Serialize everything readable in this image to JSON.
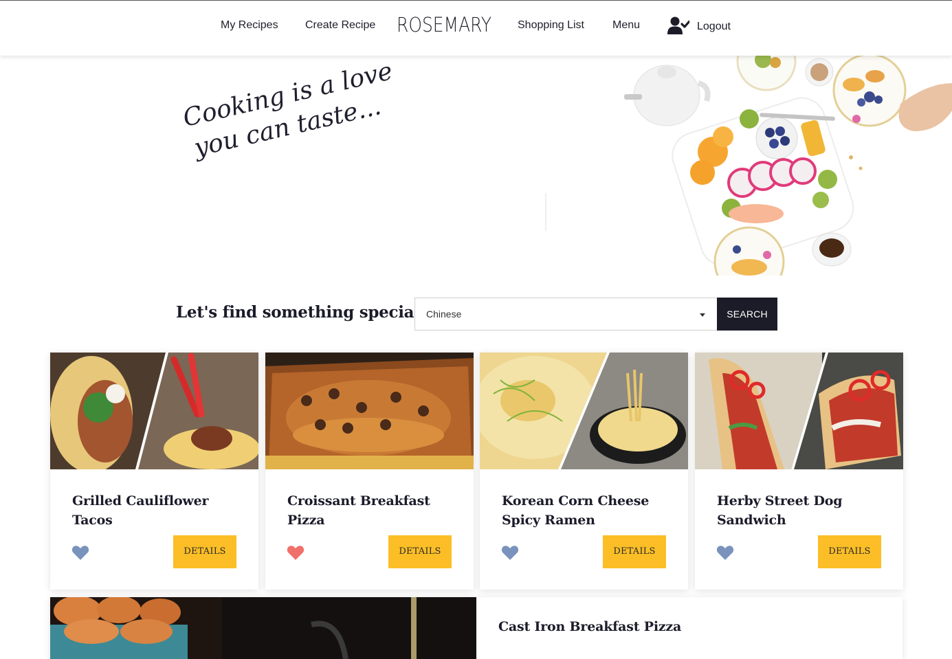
{
  "nav": {
    "my_recipes": "My Recipes",
    "create_recipe": "Create Recipe",
    "brand": "ROSEMARY",
    "shopping_list": "Shopping List",
    "menu": "Menu",
    "logout": "Logout",
    "user_icon": "user-check-icon"
  },
  "hero": {
    "tagline_line1": "Cooking is a love",
    "tagline_line2": "you can taste..."
  },
  "search": {
    "heading": "Let's find something special",
    "selected_cuisine": "Chinese",
    "button_label": "SEARCH"
  },
  "recipes": [
    {
      "title": "Grilled Cauliflower Tacos",
      "favorited": false,
      "details_label": "DETAILS"
    },
    {
      "title": "Croissant Breakfast Pizza",
      "favorited": true,
      "details_label": "DETAILS"
    },
    {
      "title": "Korean Corn Cheese Spicy Ramen",
      "favorited": false,
      "details_label": "DETAILS"
    },
    {
      "title": "Herby Street Dog Sandwich",
      "favorited": false,
      "details_label": "DETAILS"
    }
  ],
  "featured": {
    "title": "Cast Iron Breakfast Pizza"
  },
  "colors": {
    "accent_button": "#fbbe26",
    "dark_button": "#1c1c28",
    "heart_active": "#f0706a",
    "heart_inactive": "#7a93bd"
  }
}
